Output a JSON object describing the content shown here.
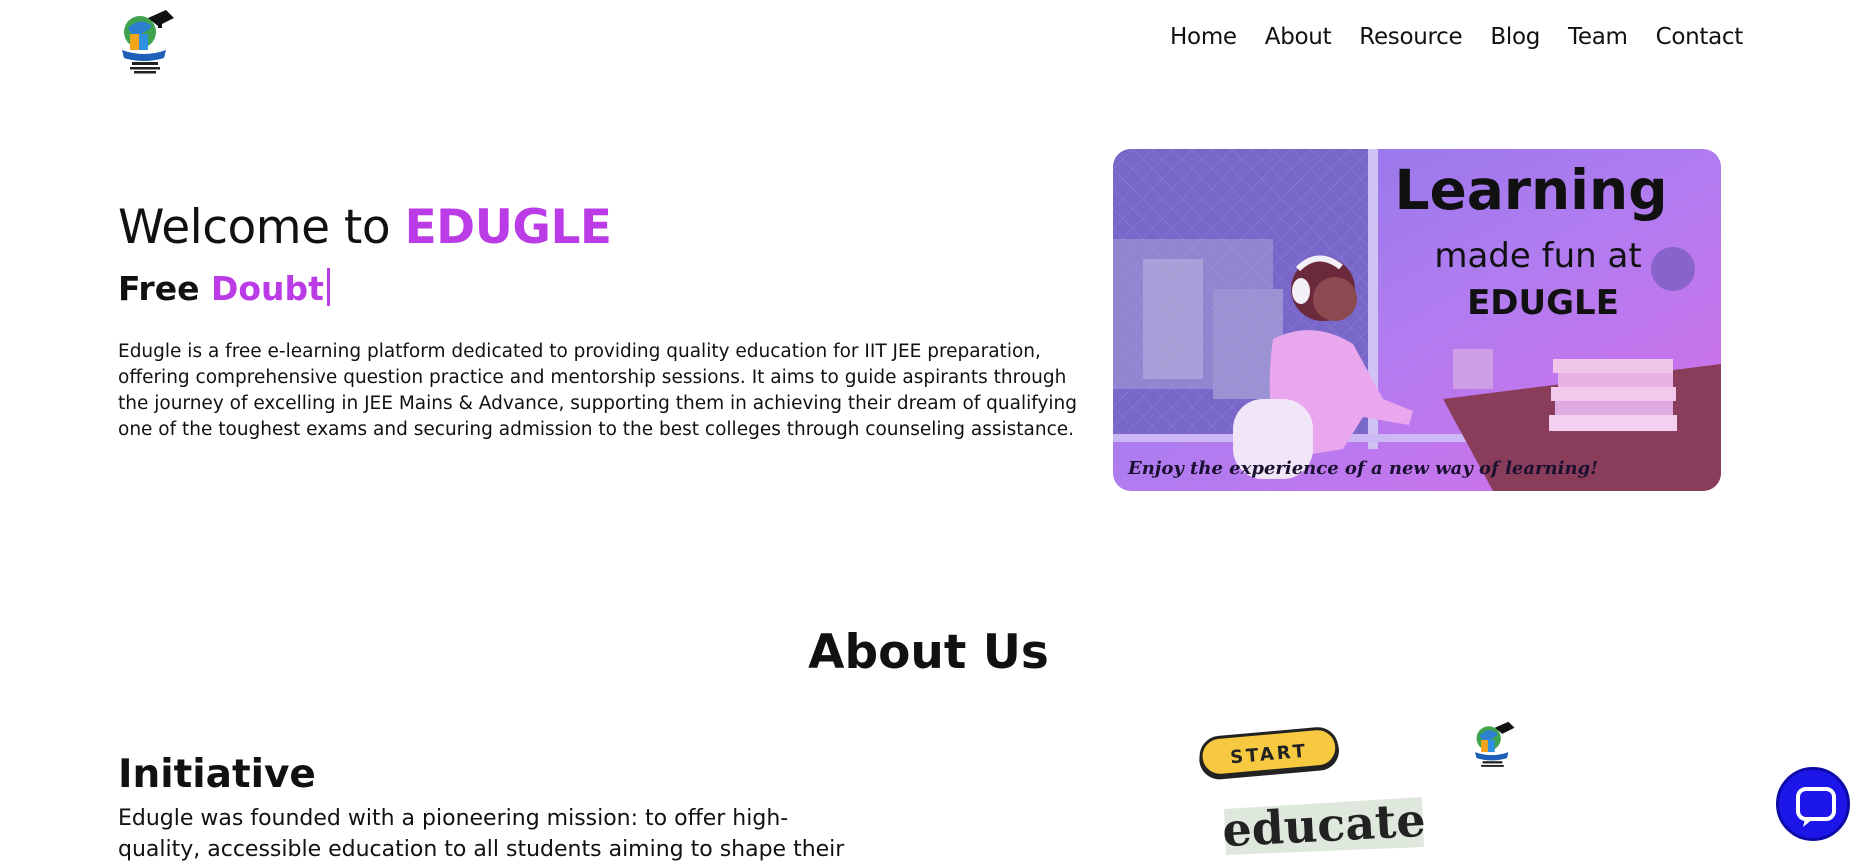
{
  "nav": {
    "logo_icon": "edugle-logo-icon",
    "links": [
      "Home",
      "About",
      "Resource",
      "Blog",
      "Team",
      "Contact"
    ]
  },
  "hero": {
    "title_prefix": "Welcome to",
    "brand": "EDUGLE",
    "subtitle_static": "Free",
    "subtitle_typed": "Doubt",
    "description": "Edugle is a free e-learning platform dedicated to providing quality education for IIT JEE preparation, offering comprehensive question practice and mentorship sessions. It aims to guide aspirants through the journey of excelling in JEE Mains & Advance, supporting them in achieving their dream of qualifying one of the toughest exams and securing admission to the best colleges through counseling assistance.",
    "image": {
      "heading": "Learning",
      "line2": "made fun at",
      "line3": "EDUGLE",
      "caption": "Enjoy the experience of a new way of learning!"
    }
  },
  "about": {
    "title": "About Us",
    "initiative_title": "Initiative",
    "initiative_text": "Edugle was founded with a pioneering mission: to offer high-quality, accessible education to all students aiming to shape their futures by",
    "badge_start": "START",
    "educate_word": "educate"
  },
  "chat": {
    "icon": "chat-bubble-icon"
  },
  "colors": {
    "brand": "#bb3ce6",
    "chat": "#1c16e8"
  }
}
